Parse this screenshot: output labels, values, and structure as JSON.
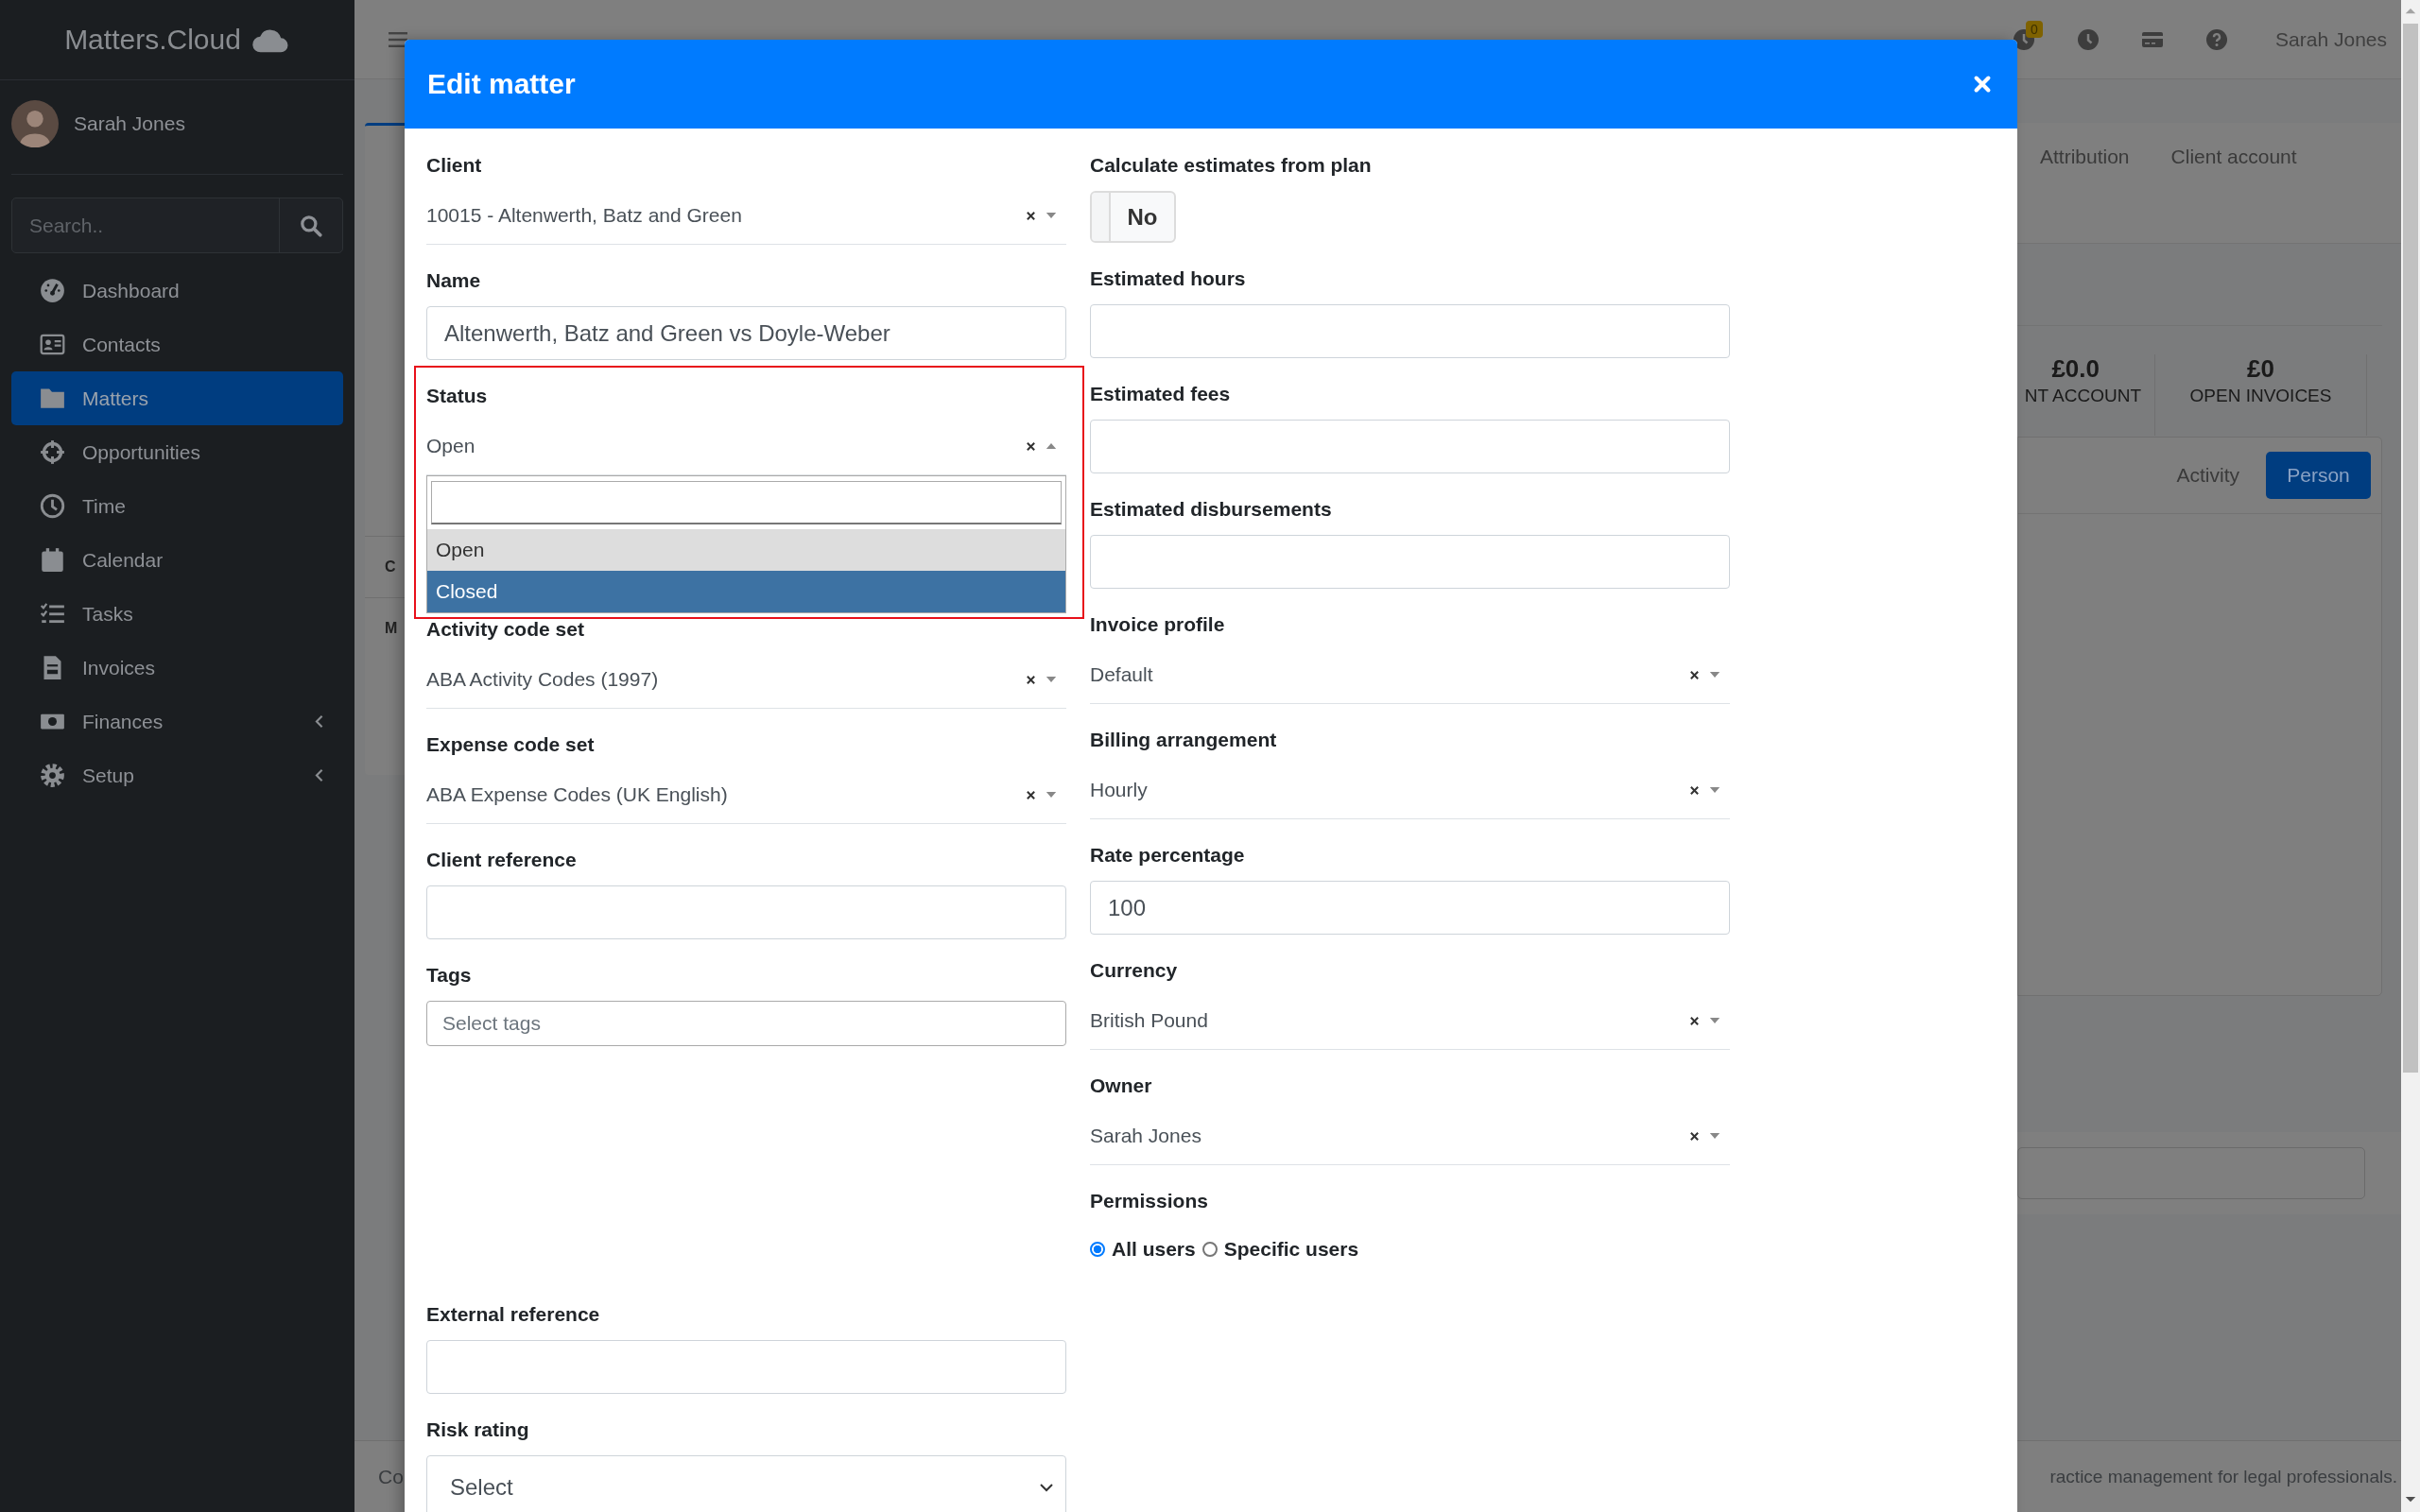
{
  "sidebar": {
    "brand": "Matters.Cloud",
    "user": {
      "name": "Sarah Jones"
    },
    "search": {
      "placeholder": "Search.."
    },
    "items": [
      {
        "label": "Dashboard",
        "selected": false,
        "has_submenu": false
      },
      {
        "label": "Contacts",
        "selected": false,
        "has_submenu": false
      },
      {
        "label": "Matters",
        "selected": true,
        "has_submenu": false
      },
      {
        "label": "Opportunities",
        "selected": false,
        "has_submenu": false
      },
      {
        "label": "Time",
        "selected": false,
        "has_submenu": false
      },
      {
        "label": "Calendar",
        "selected": false,
        "has_submenu": false
      },
      {
        "label": "Tasks",
        "selected": false,
        "has_submenu": false
      },
      {
        "label": "Invoices",
        "selected": false,
        "has_submenu": false
      },
      {
        "label": "Finances",
        "selected": false,
        "has_submenu": true
      },
      {
        "label": "Setup",
        "selected": false,
        "has_submenu": true
      }
    ]
  },
  "topbar": {
    "timer_badge": "0",
    "user_name": "Sarah Jones"
  },
  "background": {
    "tabs": [
      {
        "label": "Attribution"
      },
      {
        "label": "Client account"
      }
    ],
    "stats": [
      {
        "value": "£0.0",
        "label": "NT ACCOUNT"
      },
      {
        "value": "£0",
        "label": "OPEN INVOICES"
      }
    ],
    "card_rows": [
      "C",
      "M"
    ],
    "panel_tabs": [
      {
        "label": "Activity",
        "selected": false
      },
      {
        "label": "Person",
        "selected": true
      }
    ],
    "footer_left": "Co",
    "footer_right": "ractice management for legal professionals."
  },
  "modal": {
    "title": "Edit matter",
    "left_fields": [
      {
        "kind": "select",
        "label": "Client",
        "value": "10015 - Altenwerth, Batz and Green",
        "open": false,
        "highlighted": false
      },
      {
        "kind": "text",
        "label": "Name",
        "value": "Altenwerth, Batz and Green vs Doyle-Weber",
        "highlighted": false
      },
      {
        "kind": "select",
        "label": "Status",
        "value": "Open",
        "open": true,
        "highlighted": true,
        "options": [
          {
            "label": "Open",
            "selected": true,
            "highlighted": false
          },
          {
            "label": "Closed",
            "selected": false,
            "highlighted": true
          }
        ]
      },
      {
        "kind": "select",
        "label": "Activity code set",
        "value": "ABA Activity Codes (1997)",
        "open": false,
        "highlighted": false
      },
      {
        "kind": "select",
        "label": "Expense code set",
        "value": "ABA Expense Codes (UK English)",
        "open": false,
        "highlighted": false
      },
      {
        "kind": "text",
        "label": "Client reference",
        "highlighted": false
      },
      {
        "kind": "tags",
        "label": "Tags",
        "placeholder": "Select tags",
        "highlighted": false
      },
      {
        "kind": "text",
        "label": "External reference",
        "highlighted": false
      },
      {
        "kind": "native-select",
        "label": "Risk rating",
        "value": "Select",
        "highlighted": false
      }
    ],
    "right_fields": [
      {
        "kind": "toggle",
        "label": "Calculate estimates from plan",
        "value": "No",
        "on": false,
        "highlighted": false
      },
      {
        "kind": "text",
        "label": "Estimated hours",
        "highlighted": false
      },
      {
        "kind": "text",
        "label": "Estimated fees",
        "highlighted": false
      },
      {
        "kind": "text",
        "label": "Estimated disbursements",
        "highlighted": false
      },
      {
        "kind": "select",
        "label": "Invoice profile",
        "value": "Default",
        "open": false,
        "highlighted": false
      },
      {
        "kind": "select",
        "label": "Billing arrangement",
        "value": "Hourly",
        "open": false,
        "highlighted": false
      },
      {
        "kind": "text",
        "label": "Rate percentage",
        "value": "100",
        "highlighted": false
      },
      {
        "kind": "select",
        "label": "Currency",
        "value": "British Pound",
        "open": false,
        "highlighted": false
      },
      {
        "kind": "select",
        "label": "Owner",
        "value": "Sarah Jones",
        "open": false,
        "highlighted": false
      },
      {
        "kind": "radio",
        "label": "Permissions",
        "highlighted": false,
        "options": [
          {
            "label": "All users",
            "selected": true
          },
          {
            "label": "Specific users",
            "selected": false
          }
        ]
      }
    ]
  }
}
